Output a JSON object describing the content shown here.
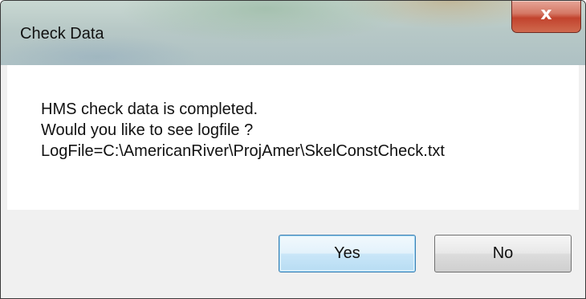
{
  "window": {
    "title": "Check Data",
    "close_glyph": "x"
  },
  "message": {
    "line1": "HMS check data is completed.",
    "line2": "Would you like to see logfile ?",
    "line3": "LogFile=C:\\AmericanRiver\\ProjAmer\\SkelConstCheck.txt"
  },
  "buttons": {
    "yes_label": "Yes",
    "no_label": "No"
  }
}
